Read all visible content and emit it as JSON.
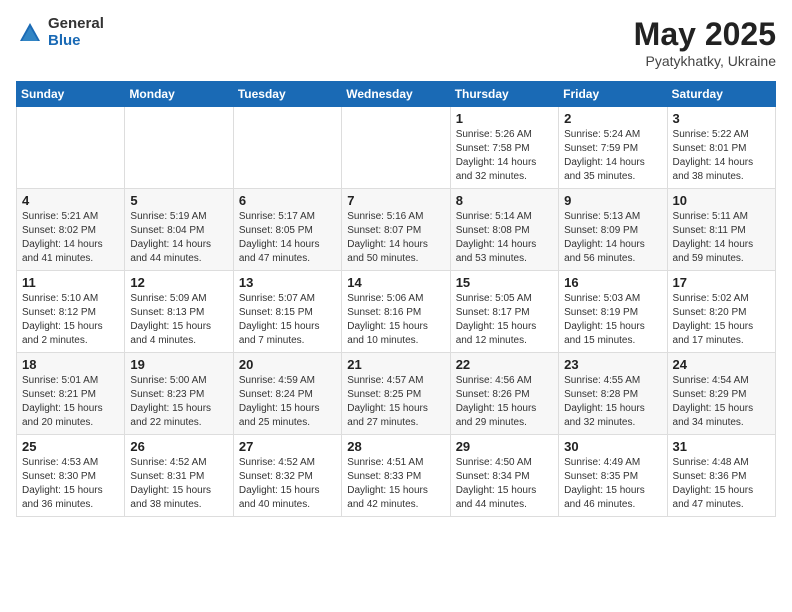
{
  "header": {
    "logo_general": "General",
    "logo_blue": "Blue",
    "month_year": "May 2025",
    "location": "Pyatykhatky, Ukraine"
  },
  "weekdays": [
    "Sunday",
    "Monday",
    "Tuesday",
    "Wednesday",
    "Thursday",
    "Friday",
    "Saturday"
  ],
  "weeks": [
    [
      {
        "day": "",
        "info": ""
      },
      {
        "day": "",
        "info": ""
      },
      {
        "day": "",
        "info": ""
      },
      {
        "day": "",
        "info": ""
      },
      {
        "day": "1",
        "info": "Sunrise: 5:26 AM\nSunset: 7:58 PM\nDaylight: 14 hours\nand 32 minutes."
      },
      {
        "day": "2",
        "info": "Sunrise: 5:24 AM\nSunset: 7:59 PM\nDaylight: 14 hours\nand 35 minutes."
      },
      {
        "day": "3",
        "info": "Sunrise: 5:22 AM\nSunset: 8:01 PM\nDaylight: 14 hours\nand 38 minutes."
      }
    ],
    [
      {
        "day": "4",
        "info": "Sunrise: 5:21 AM\nSunset: 8:02 PM\nDaylight: 14 hours\nand 41 minutes."
      },
      {
        "day": "5",
        "info": "Sunrise: 5:19 AM\nSunset: 8:04 PM\nDaylight: 14 hours\nand 44 minutes."
      },
      {
        "day": "6",
        "info": "Sunrise: 5:17 AM\nSunset: 8:05 PM\nDaylight: 14 hours\nand 47 minutes."
      },
      {
        "day": "7",
        "info": "Sunrise: 5:16 AM\nSunset: 8:07 PM\nDaylight: 14 hours\nand 50 minutes."
      },
      {
        "day": "8",
        "info": "Sunrise: 5:14 AM\nSunset: 8:08 PM\nDaylight: 14 hours\nand 53 minutes."
      },
      {
        "day": "9",
        "info": "Sunrise: 5:13 AM\nSunset: 8:09 PM\nDaylight: 14 hours\nand 56 minutes."
      },
      {
        "day": "10",
        "info": "Sunrise: 5:11 AM\nSunset: 8:11 PM\nDaylight: 14 hours\nand 59 minutes."
      }
    ],
    [
      {
        "day": "11",
        "info": "Sunrise: 5:10 AM\nSunset: 8:12 PM\nDaylight: 15 hours\nand 2 minutes."
      },
      {
        "day": "12",
        "info": "Sunrise: 5:09 AM\nSunset: 8:13 PM\nDaylight: 15 hours\nand 4 minutes."
      },
      {
        "day": "13",
        "info": "Sunrise: 5:07 AM\nSunset: 8:15 PM\nDaylight: 15 hours\nand 7 minutes."
      },
      {
        "day": "14",
        "info": "Sunrise: 5:06 AM\nSunset: 8:16 PM\nDaylight: 15 hours\nand 10 minutes."
      },
      {
        "day": "15",
        "info": "Sunrise: 5:05 AM\nSunset: 8:17 PM\nDaylight: 15 hours\nand 12 minutes."
      },
      {
        "day": "16",
        "info": "Sunrise: 5:03 AM\nSunset: 8:19 PM\nDaylight: 15 hours\nand 15 minutes."
      },
      {
        "day": "17",
        "info": "Sunrise: 5:02 AM\nSunset: 8:20 PM\nDaylight: 15 hours\nand 17 minutes."
      }
    ],
    [
      {
        "day": "18",
        "info": "Sunrise: 5:01 AM\nSunset: 8:21 PM\nDaylight: 15 hours\nand 20 minutes."
      },
      {
        "day": "19",
        "info": "Sunrise: 5:00 AM\nSunset: 8:23 PM\nDaylight: 15 hours\nand 22 minutes."
      },
      {
        "day": "20",
        "info": "Sunrise: 4:59 AM\nSunset: 8:24 PM\nDaylight: 15 hours\nand 25 minutes."
      },
      {
        "day": "21",
        "info": "Sunrise: 4:57 AM\nSunset: 8:25 PM\nDaylight: 15 hours\nand 27 minutes."
      },
      {
        "day": "22",
        "info": "Sunrise: 4:56 AM\nSunset: 8:26 PM\nDaylight: 15 hours\nand 29 minutes."
      },
      {
        "day": "23",
        "info": "Sunrise: 4:55 AM\nSunset: 8:28 PM\nDaylight: 15 hours\nand 32 minutes."
      },
      {
        "day": "24",
        "info": "Sunrise: 4:54 AM\nSunset: 8:29 PM\nDaylight: 15 hours\nand 34 minutes."
      }
    ],
    [
      {
        "day": "25",
        "info": "Sunrise: 4:53 AM\nSunset: 8:30 PM\nDaylight: 15 hours\nand 36 minutes."
      },
      {
        "day": "26",
        "info": "Sunrise: 4:52 AM\nSunset: 8:31 PM\nDaylight: 15 hours\nand 38 minutes."
      },
      {
        "day": "27",
        "info": "Sunrise: 4:52 AM\nSunset: 8:32 PM\nDaylight: 15 hours\nand 40 minutes."
      },
      {
        "day": "28",
        "info": "Sunrise: 4:51 AM\nSunset: 8:33 PM\nDaylight: 15 hours\nand 42 minutes."
      },
      {
        "day": "29",
        "info": "Sunrise: 4:50 AM\nSunset: 8:34 PM\nDaylight: 15 hours\nand 44 minutes."
      },
      {
        "day": "30",
        "info": "Sunrise: 4:49 AM\nSunset: 8:35 PM\nDaylight: 15 hours\nand 46 minutes."
      },
      {
        "day": "31",
        "info": "Sunrise: 4:48 AM\nSunset: 8:36 PM\nDaylight: 15 hours\nand 47 minutes."
      }
    ]
  ]
}
